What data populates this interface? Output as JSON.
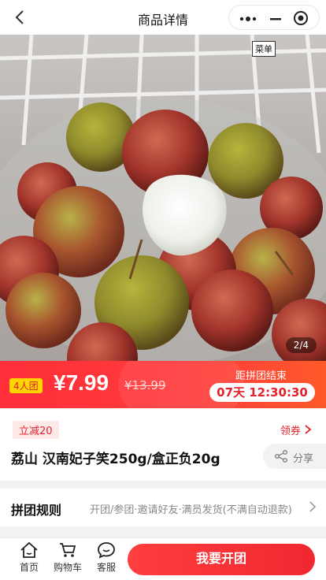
{
  "nav": {
    "title": "商品详情",
    "back_icon": "chevron-left-icon",
    "more_icon": "more-dots-icon",
    "minimize_icon": "minimize-icon",
    "close_icon": "target-circle-icon"
  },
  "gallery": {
    "menu_tag": "菜单",
    "page_indicator": "2/4"
  },
  "price": {
    "group_badge": "4人团",
    "current": "¥7.99",
    "original": "¥13.99",
    "countdown_label": "距拼团结束",
    "countdown": "07天 12:30:30"
  },
  "info": {
    "discount_tag": "立减20",
    "coupon_link": "领券",
    "title": "荔山 汉南妃子笑250g/盒正负20g",
    "share_label": "分享"
  },
  "rules": {
    "title": "拼团规则",
    "description": "开团/参团·邀请好友·满员发货(不满自动退款)"
  },
  "bottom": {
    "tabs": [
      {
        "label": "首页",
        "icon": "home-icon"
      },
      {
        "label": "购物车",
        "icon": "cart-icon"
      },
      {
        "label": "客服",
        "icon": "chat-icon"
      }
    ],
    "cta": "我要开团"
  },
  "colors": {
    "accent": "#e3222b",
    "badge": "#ffd400"
  }
}
